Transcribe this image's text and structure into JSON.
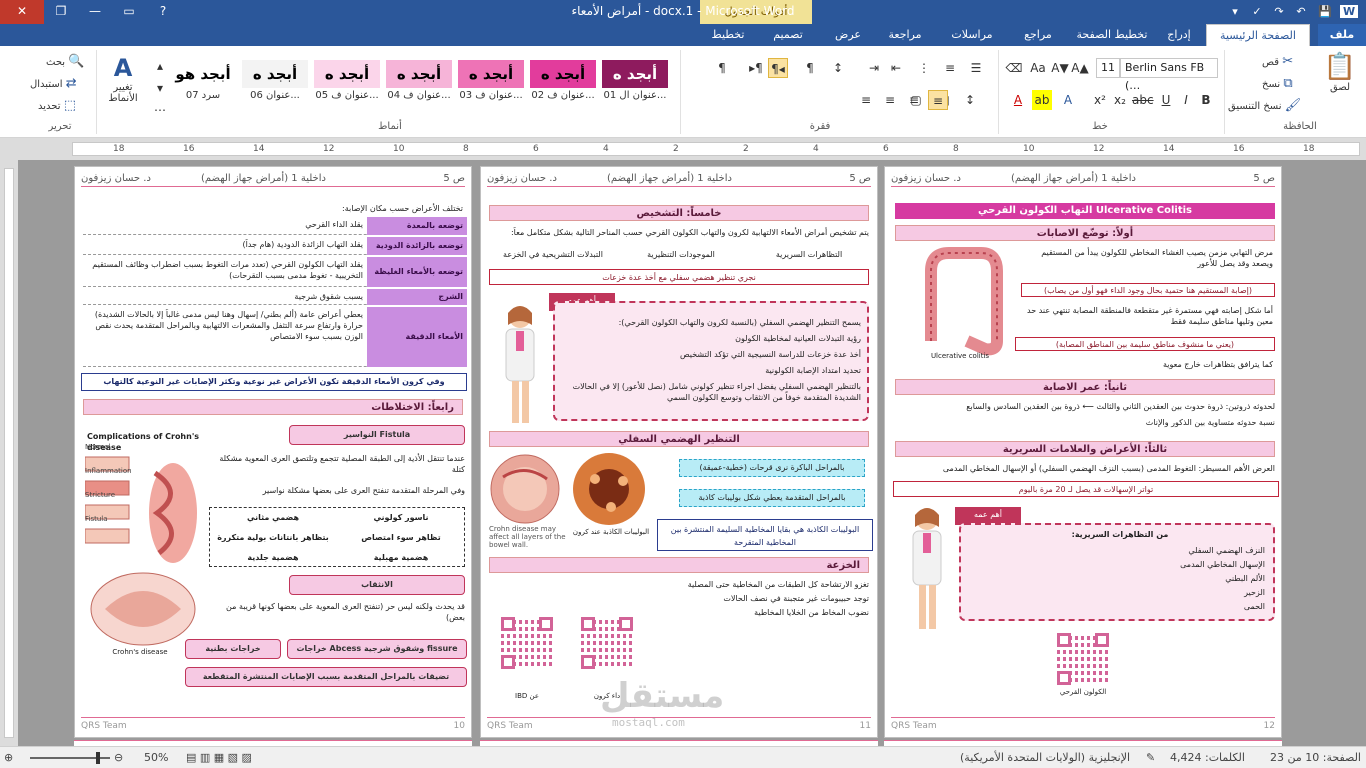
{
  "window": {
    "title": "أمراض الأمعاء - docx.1 - Microsoft Word",
    "context_tab_group": "أدوات الجدول",
    "qat": [
      "save-icon",
      "undo-icon",
      "redo-icon",
      "spelling-icon",
      "customize-icon"
    ]
  },
  "tabs": [
    "ملف",
    "الصفحة الرئيسية",
    "إدراج",
    "تخطيط الصفحة",
    "مراجع",
    "مراسلات",
    "مراجعة",
    "عرض",
    "تصميم",
    "تخطيط"
  ],
  "ribbon": {
    "clipboard": {
      "paste": "لصق",
      "cut": "قص",
      "copy": "نسخ",
      "format_painter": "نسخ التنسيق",
      "label": "الحافظة"
    },
    "font": {
      "name": "Berlin Sans FB (…",
      "size": "11",
      "label": "خط"
    },
    "paragraph": {
      "label": "فقرة"
    },
    "styles": {
      "label": "أنماط",
      "items": [
        {
          "sample": "أبجد ه",
          "name": "01 عنوان ال...",
          "bg": "#8e1b5e",
          "fg": "#ffffff"
        },
        {
          "sample": "أبجد ه",
          "name": "02 عنوان ف...",
          "bg": "#e23c9c",
          "fg": "#000000"
        },
        {
          "sample": "أبجد ه",
          "name": "03 عنوان ف...",
          "bg": "#ee73b6",
          "fg": "#000000"
        },
        {
          "sample": "أبجد ه",
          "name": "04 عنوان ف...",
          "bg": "#f6b4d8",
          "fg": "#000000"
        },
        {
          "sample": "أبجد ه",
          "name": "05 عنوان ف...",
          "bg": "#fbd5ea",
          "fg": "#000000"
        },
        {
          "sample": "أبجد ه",
          "name": "06 عنوان...",
          "bg": "#f3f3f3",
          "fg": "#000000"
        },
        {
          "sample": "أبجد هو",
          "name": "07 سرد",
          "bg": "#ffffff",
          "fg": "#000000"
        }
      ],
      "change_styles": "تغيير الأنماط"
    },
    "editing": {
      "find": "بحث",
      "replace": "استبدال",
      "select": "تحديد",
      "label": "تحرير"
    }
  },
  "ruler": {
    "ticks": [
      "18",
      "16",
      "14",
      "12",
      "10",
      "8",
      "6",
      "4",
      "2",
      "2",
      "4",
      "6",
      "8",
      "10",
      "12",
      "14",
      "16",
      "18"
    ]
  },
  "pages": {
    "right": {
      "header_left": "د. حسان زيزفون",
      "header_mid": "داخلية 1 (أمراض جهاز الهضم)",
      "header_num": "ص 5",
      "title": "التهاب الكولون القرحي Ulcerative Colitis",
      "s1": "أولاً: توضّع الاصابات",
      "p1": "مرض التهابي مزمن يصيب الغشاء المخاطي للكولون يبدأ من المستقيم ويصعد وقد يصل للأعور",
      "r1": "(إصابة المستقيم هنا حتمية بحال وجود الداء فهو أول من يصاب)",
      "p2": "أما شكل إصابته فهي مستمرة غير متقطعة فالمنطقة المصابة تنتهي عند حد معين وتليها مناطق سليمة فقط",
      "r2": "(يعني ما منشوف مناطق سليمة بين المناطق المصابة)",
      "p3": "كما يترافق بتظاهرات خارج معوية",
      "fig_caption": "Ulcerative colitis",
      "s2": "ثانياً: عمر الاصابة",
      "p4": "لحدوثه ذروتين: ذروة حدوث بين العقدين الثاني والثالث ⟵ ذروة بين العقدين السادس والسابع",
      "p5": "نسبة حدوثه متساوية بين الذكور والإناث",
      "s3": "ثالثاً: الأعراض والعلامات السريرية",
      "p6": "العرض الأهم المسيطر: التغوط المدمى (بسبب النزف الهضمي السفلي) أو الإسهال المخاطي المدمى",
      "r3": "تواتر الإسهالات قد يصل لـ 20 مرة باليوم",
      "callout": "أهم عمه",
      "box_title": "من التظاهرات السريرية:",
      "box_items": [
        "النزف الهضمي السفلي",
        "الإسهال المخاطي المدمى",
        "الألم البطني",
        "الزحير",
        "الحمى"
      ],
      "qr_caption": "الكولون القرحي",
      "footer_left": "QRS Team",
      "footer_num": "12"
    },
    "middle": {
      "header_left": "د. حسان زيزفون",
      "header_mid": "داخلية 1 (أمراض جهاز الهضم)",
      "header_num": "ص 5",
      "s1": "خامساً: التشخيص",
      "p1": "يتم تشخيص أمراض الأمعاء الالتهابية لكرون والتهاب الكولون القرحي حسب المناحر التالية بشكل متكامل معاً:",
      "cols": [
        "التظاهرات السريرية",
        "الموجودات التنظيرية",
        "التبدلات التشريحية في الخزعة"
      ],
      "r1": "نجري تنظير هضمي سفلي مع أخذ عدة خزعات",
      "callout": "أهم عمه",
      "box_items": [
        "يسمح التنظير الهضمي السفلي (بالنسبة لكرون والتهاب الكولون القرحي):",
        "رؤية التبدلات العيانية لمخاطية الكولون",
        "أخذ عدة خزعات للدراسة النسيجية التي تؤكد التشخيص",
        "تحديد امتداد الإصابة الكولونية",
        "بالتنظير الهضمي السفلي يفضل اجراء تنظير كولوني شامل (نصل للأعور) إلا في الحالات الشديدة المتقدمة خوفاً من الانثقاب وتوسع الكولون السمي"
      ],
      "s2": "التنظير الهضمي السفلي",
      "fig1_caption": "Crohn disease may affect all layers of the bowel wall.",
      "fig2_caption": "البوليبات الكاذبة عند كرون",
      "cy1": "بالمراحل الباكرة نرى قرحات (خطية-عميقة)",
      "cy2": "بالمراحل المتقدمة يعطي شكل بوليبات كاذبة",
      "box2": "البوليبات الكاذبة هي بقايا المخاطية السليمة المنتشرة بين المخاطية المتقرحة",
      "s3": "الخزعة",
      "list": [
        "تغزو الارتشاحة كل الطبقات من المخاطية حتى المصلية",
        "توجد حبيبومات غير متجبنة في نصف الحالات",
        "نضوب المخاط من الخلايا المخاطية"
      ],
      "qr1": "داء كرون",
      "qr2": "عن IBD",
      "footer_left": "QRS Team",
      "footer_num": "11"
    },
    "left": {
      "header_left": "د. حسان زيزفون",
      "header_mid": "داخلية 1 (أمراض جهاز الهضم)",
      "header_num": "ص 5",
      "intro": "تختلف الأعراض حسب مكان الإصابة:",
      "rows": [
        {
          "k": "توضعه بالمعدة",
          "v": "يقلد الداء القرحي"
        },
        {
          "k": "توضعه بالزائدة الدودية",
          "v": "يقلد التهاب الزائدة الدودية (هام جداً)"
        },
        {
          "k": "توضعه بالأمعاء الغليظة",
          "v": "يقلد التهاب الكولون القرحي (تعدد مرات التغوط بسبب اضطراب وظائف المستقيم التخريبية - تغوط مدمى بسبب التقرحات)"
        },
        {
          "k": "الشرج",
          "v": "يسبب شقوق شرجية"
        },
        {
          "k": "الأمعاء الدقيقة",
          "v": "يعطي أعراض عامة (ألم بطني/ إسهال وهنا ليس مدمى غالباً إلا بالحالات الشديدة) حرارة وارتفاع سرعة التثفل والمشعرات الالتهابية وبالمراحل المتقدمة يحدث نقص الوزن بسبب سوء الامتصاص"
        }
      ],
      "blue_note": "وفي كرون الأمعاء الدقيقة تكون الأعراض غير نوعية وتكثر الإصابات غير النوعية كالتهاب المفاصل والنواسير وغيرها",
      "s1": "رابعاً: الاختلاطات",
      "fig_title": "Complications of Crohn's disease",
      "fig_labels": [
        "Normal",
        "Inflammation",
        "Stricture",
        "Fistula"
      ],
      "fig_caption": "Crohn's disease",
      "fistula": "النواسير Fistula",
      "f1": "عندما تنتقل الأذية إلى الطبقة المصلية تتجمع وتلتصق العرى المعوية مشكلة كتلة",
      "f2": "وفي المرحلة المتقدمة تنفتح العرى على بعضها مشكلة نواسير",
      "grid": [
        "ناسور كولوني",
        "هضمي مثاني",
        "تظاهر سوء امتصاص",
        "بتظاهر بانتانات بولية متكررة",
        "هضمية مهبلية",
        "هضمية جلدية"
      ],
      "perf": "الانثقاب",
      "p_perf": "قد يحدث ولكنه ليس حر (تنفتح العرى المعوية على بعضها كونها قريبة من بعض)",
      "btn1": "خراجات Abcess وشقوق شرجية fissure",
      "btn2": "خراجات بطنية",
      "btn3": "تضيقات بالمراحل المتقدمة بسبب الإصابات المنتشرة المتقطعة",
      "footer_left": "QRS Team",
      "footer_num": "10"
    }
  },
  "statusbar": {
    "page": "الصفحة: 10 من 23",
    "words": "الكلمات: 4,424",
    "language": "الإنجليزية (الولايات المتحدة الأمريكية)",
    "zoom": "50%"
  },
  "watermark": {
    "brand": "مستقل",
    "url": "mostaql.com"
  }
}
